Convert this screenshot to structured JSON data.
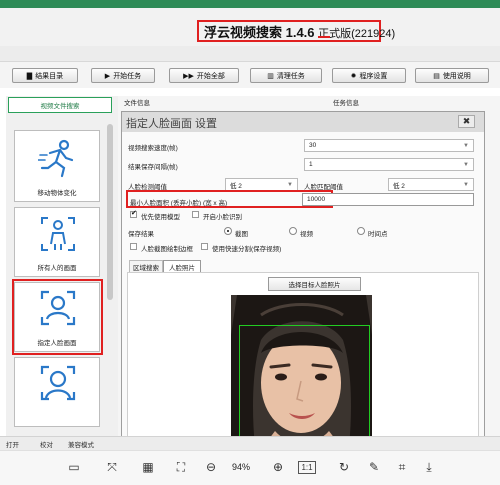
{
  "app": {
    "title_main": "浮云视频搜索 1.4.6 ",
    "title_edition": "正式版",
    "title_build": "(221924)"
  },
  "toolbar": {
    "buttons": [
      {
        "icon": "folder-icon",
        "label": "结果目录"
      },
      {
        "icon": "play-icon",
        "label": "开始任务"
      },
      {
        "icon": "fast-forward-icon",
        "label": "开始全部"
      },
      {
        "icon": "trash-icon",
        "label": "清理任务"
      },
      {
        "icon": "gear-icon",
        "label": "程序设置"
      },
      {
        "icon": "book-icon",
        "label": "使用说明"
      }
    ]
  },
  "sidebar": {
    "header": "视频文件搜索",
    "items": [
      {
        "label": "移动物体变化",
        "icon": "running-person-icon"
      },
      {
        "label": "所有人的画面",
        "icon": "person-scan-icon"
      },
      {
        "label": "指定人脸画面",
        "icon": "face-scan-icon"
      },
      {
        "label": "",
        "icon": "face-profile-icon"
      }
    ]
  },
  "main": {
    "col_file": "文件信息",
    "col_task": "任务信息"
  },
  "dialog": {
    "title": "指定人脸画面 设置",
    "close": "✖",
    "fields": {
      "speed_label": "视频搜索速度(帧)",
      "speed_value": "30",
      "interval_label": "结果保存间隔(帧)",
      "interval_value": "1",
      "detect_label": "人脸检测阈值",
      "detect_value": "低 2",
      "match_label": "人脸匹配阈值",
      "match_value": "低 2",
      "minface_label": "最小人脸面积 (丢弃小脸) (宽 x 高)",
      "minface_value": "10000"
    },
    "options": {
      "prefer_small_label": "优先使用模型",
      "prefer_small_checked": true,
      "enable_small_label": "开启小脸识别",
      "enable_small_checked": false
    },
    "save": {
      "label": "保存结果",
      "options": [
        {
          "label": "截图",
          "selected": true
        },
        {
          "label": "视频",
          "selected": false
        },
        {
          "label": "时间点",
          "selected": false
        }
      ],
      "draw_box_label": "人脸截图绘制边框",
      "fast_split_label": "使用快速分割(保存视频)"
    },
    "tabs": [
      "区域搜索",
      "人脸照片"
    ],
    "active_tab": 1,
    "select_photo_button": "选择目标人脸照片"
  },
  "statusbar": {
    "items": [
      "打开",
      "校对",
      "兼容模式"
    ]
  },
  "viewer": {
    "zoom": "94%",
    "actual_size": "1:1"
  },
  "colors": {
    "highlight_red": "#e02020",
    "accent_green": "#2aa05a",
    "face_box_green": "#22cc22"
  }
}
